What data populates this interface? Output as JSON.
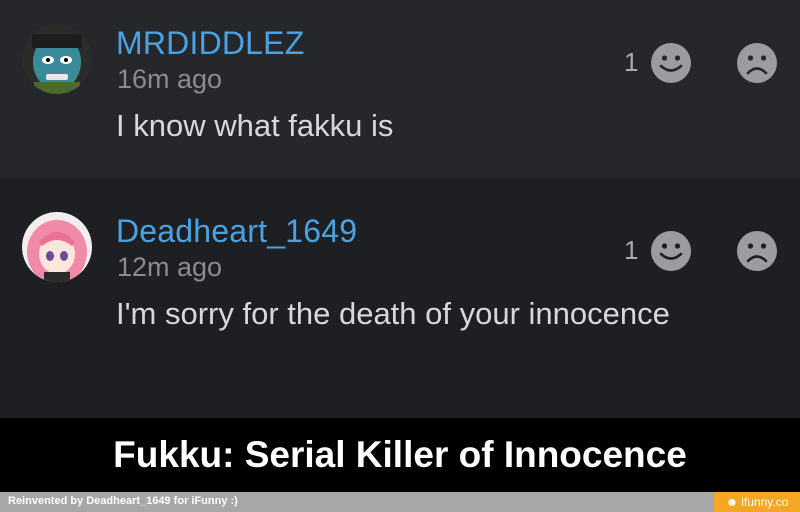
{
  "comments": [
    {
      "username": "MRDIDDLEZ",
      "time": "16m ago",
      "text": "I know what fakku is",
      "like_count": "1",
      "like_icon": "smile-icon",
      "dislike_icon": "frown-icon"
    },
    {
      "username": "Deadheart_1649",
      "time": "12m ago",
      "text": "I'm sorry for the death of your innocence",
      "like_count": "1",
      "like_icon": "smile-icon",
      "dislike_icon": "frown-icon"
    }
  ],
  "caption": "Fukku: Serial Killer of Innocence",
  "footer": {
    "credit": "Reinvented by Deadheart_1649 for iFunny :)",
    "brand": "ifunny.co"
  },
  "colors": {
    "username": "#4aa3e0",
    "brand": "#f5a623"
  }
}
